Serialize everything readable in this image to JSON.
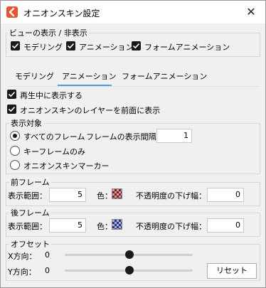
{
  "window": {
    "title": "オニオンスキン設定",
    "close": "✕"
  },
  "view": {
    "label": "ビューの表示 / 非表示",
    "options": [
      "モデリング",
      "アニメーション",
      "フォームアニメーション"
    ]
  },
  "tabs": [
    "モデリング",
    "アニメーション",
    "フォームアニメーション"
  ],
  "active_tab": "アニメーション",
  "options": {
    "show_during_playback": "再生中に表示する",
    "layer_front": "オニオンスキンのレイヤーを前面に表示"
  },
  "target": {
    "label": "表示対象",
    "all_frames": "すべてのフレーム",
    "interval_label": "フレームの表示間隔",
    "interval_value": "1",
    "keyframes_only": "キーフレームのみ",
    "onion_markers": "オニオンスキンマーカー"
  },
  "prev": {
    "label": "前フレーム",
    "range_label": "表示範囲：",
    "range_value": "5",
    "color_label": "色：",
    "opacity_label": "不透明度の下げ幅：",
    "opacity_value": "0"
  },
  "next": {
    "label": "後フレーム",
    "range_label": "表示範囲：",
    "range_value": "5",
    "color_label": "色：",
    "opacity_label": "不透明度の下げ幅：",
    "opacity_value": "0"
  },
  "offset": {
    "label": "オフセット",
    "x_label": "X方向：",
    "x_value": "0",
    "y_label": "Y方向：",
    "y_value": "0",
    "reset": "リセット"
  },
  "colors": {
    "accent": "#4aa0d8",
    "app_icon": "#e8542e"
  }
}
